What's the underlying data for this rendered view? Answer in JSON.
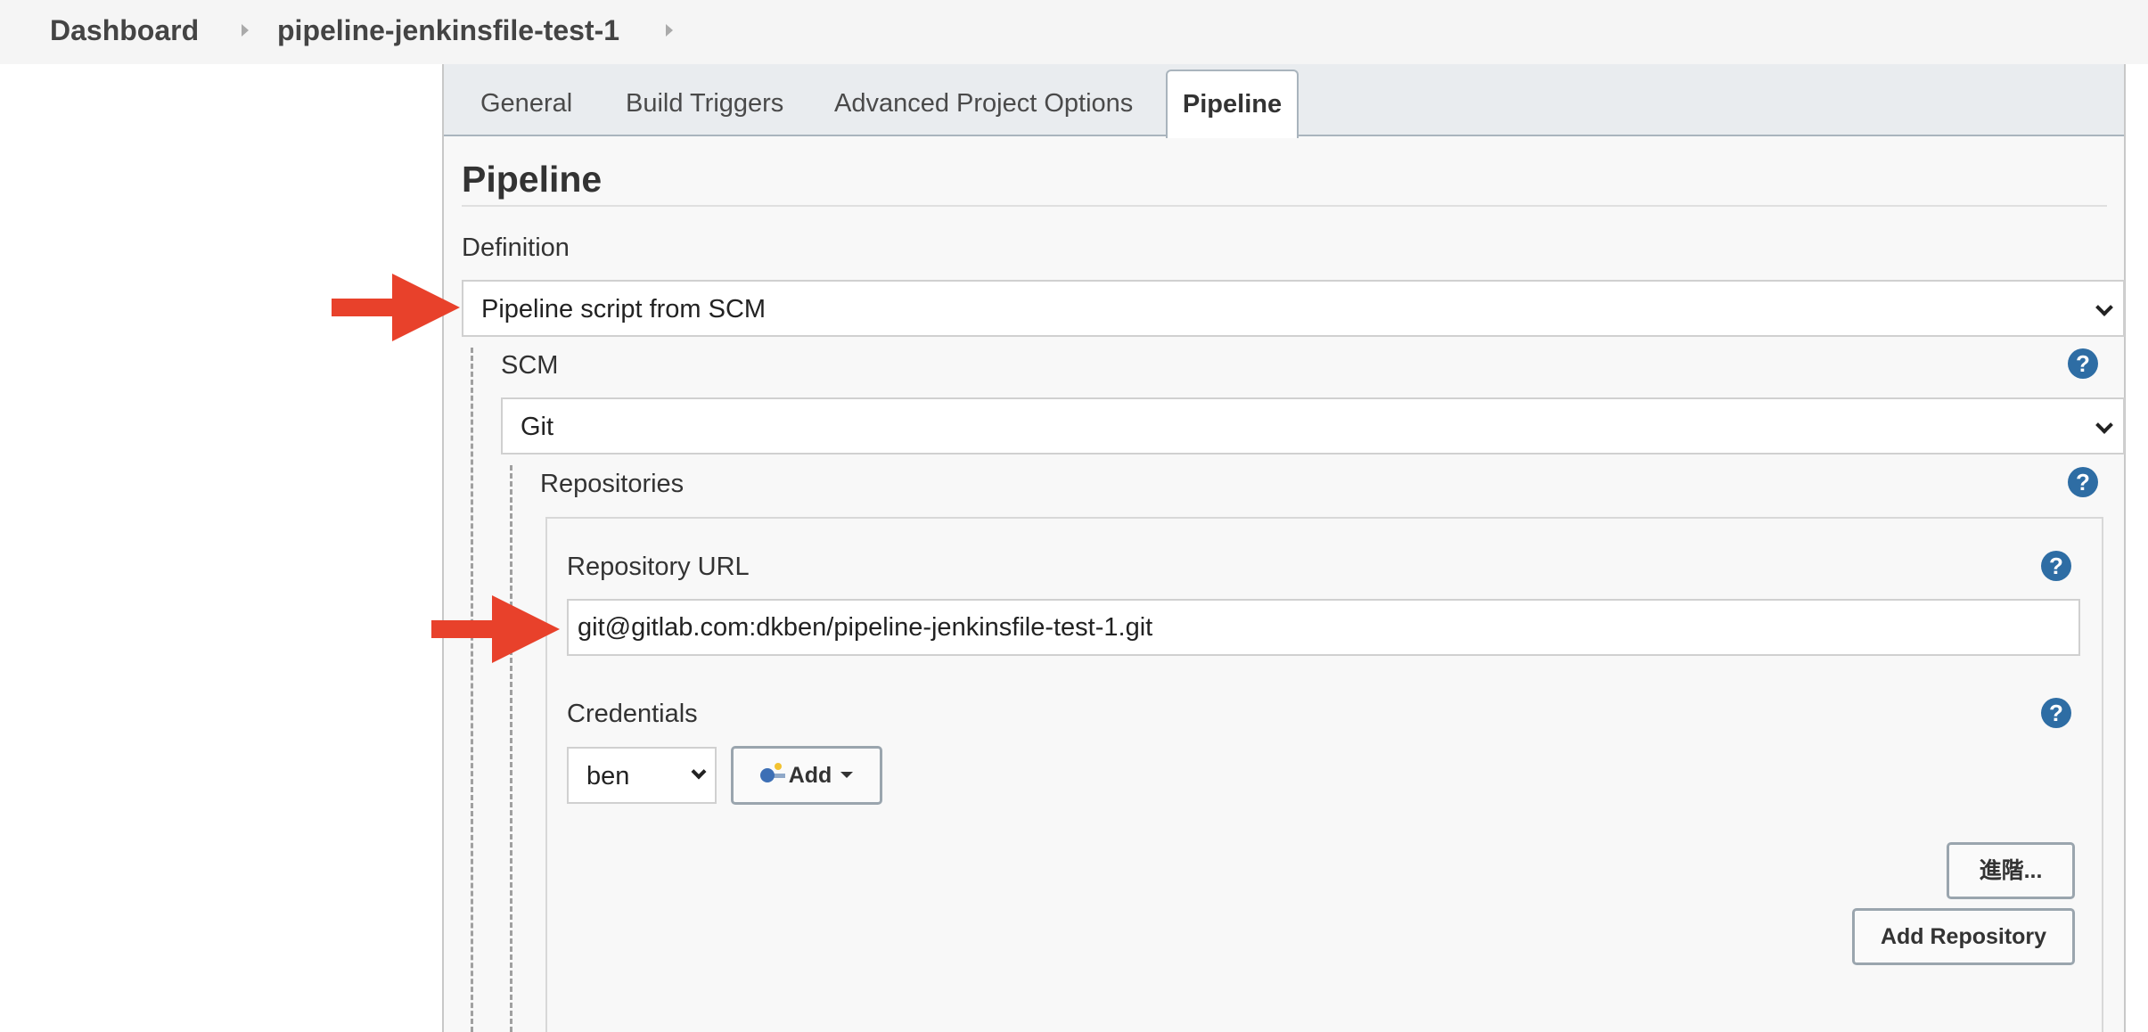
{
  "breadcrumb": {
    "dashboard": "Dashboard",
    "project": "pipeline-jenkinsfile-test-1"
  },
  "tabs": {
    "general": "General",
    "build_triggers": "Build Triggers",
    "advanced_project_options": "Advanced Project Options",
    "pipeline": "Pipeline",
    "active": "Pipeline"
  },
  "section": {
    "title": "Pipeline"
  },
  "definition": {
    "label": "Definition",
    "selected": "Pipeline script from SCM"
  },
  "scm": {
    "label": "SCM",
    "selected": "Git"
  },
  "repositories": {
    "label": "Repositories",
    "repository_url": {
      "label": "Repository URL",
      "value": "git@gitlab.com:dkben/pipeline-jenkinsfile-test-1.git"
    },
    "credentials": {
      "label": "Credentials",
      "selected": "ben",
      "add_label": "Add"
    },
    "advanced_label": "進階...",
    "add_repository_label": "Add Repository"
  },
  "help_glyph": "?",
  "colors": {
    "arrow": "#e8412b",
    "help_icon": "#2e6da4"
  }
}
